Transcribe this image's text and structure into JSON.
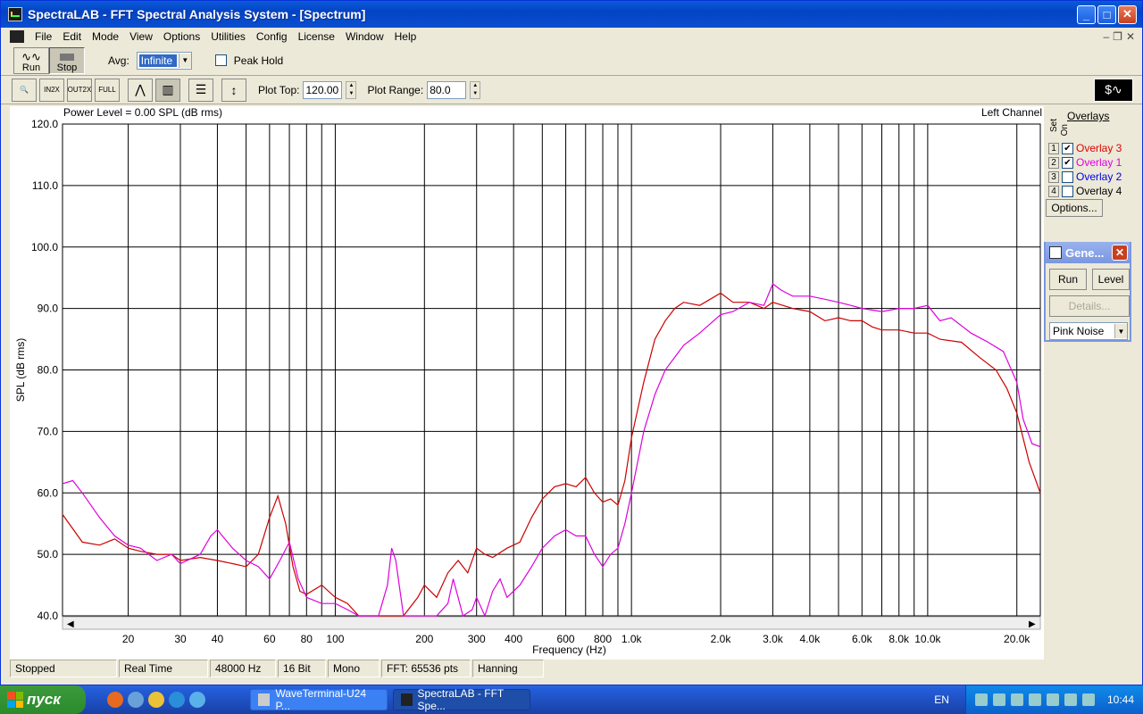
{
  "window": {
    "title": "SpectraLAB - FFT Spectral Analysis System - [Spectrum]",
    "menu": [
      "File",
      "Edit",
      "Mode",
      "View",
      "Options",
      "Utilities",
      "Config",
      "License",
      "Window",
      "Help"
    ]
  },
  "toolbar": {
    "run_label": "Run",
    "stop_label": "Stop",
    "avg_label": "Avg:",
    "avg_value": "Infinite",
    "peak_hold_label": "Peak Hold",
    "plot_top_label": "Plot Top:",
    "plot_top_value": "120.00",
    "plot_range_label": "Plot Range:",
    "plot_range_value": "80.0",
    "tools": [
      "zoom",
      "zoom-in-2x",
      "zoom-out-2x",
      "zoom-out-full",
      "line-mode",
      "bar-mode",
      "legend",
      "autoscale"
    ]
  },
  "chart": {
    "power_level": "Power Level = 0.00 SPL (dB rms)",
    "channel": "Left Channel"
  },
  "overlays": {
    "title": "Overlays",
    "set_label": "Set",
    "on_label": "On",
    "items": [
      {
        "num": "1",
        "label": "Overlay 3",
        "checked": true,
        "color": "#e00000"
      },
      {
        "num": "2",
        "label": "Overlay 1",
        "checked": true,
        "color": "#e000e0"
      },
      {
        "num": "3",
        "label": "Overlay 2",
        "checked": false,
        "color": "#0000e0"
      },
      {
        "num": "4",
        "label": "Overlay 4",
        "checked": false,
        "color": "#000000"
      }
    ],
    "options_label": "Options..."
  },
  "generator": {
    "title": "Gene...",
    "run_label": "Run",
    "level_label": "Level",
    "details_label": "Details...",
    "signal": "Pink Noise"
  },
  "status": [
    "Stopped",
    "Real Time",
    "48000 Hz",
    "16 Bit",
    "Mono",
    "FFT: 65536 pts",
    "Hanning"
  ],
  "taskbar": {
    "start_label": "пуск",
    "tasks": [
      {
        "label": "WaveTerminal-U24 P...",
        "active": false
      },
      {
        "label": "SpectraLAB - FFT Spe...",
        "active": true
      }
    ],
    "lang": "EN",
    "clock": "10:44"
  },
  "chart_data": {
    "type": "line",
    "xlabel": "Frequency (Hz)",
    "ylabel": "SPL (dB rms)",
    "x_scale": "log",
    "xlim": [
      12,
      24000
    ],
    "ylim": [
      40,
      120
    ],
    "y_ticks": [
      "40.0",
      "50.0",
      "60.0",
      "70.0",
      "80.0",
      "90.0",
      "100.0",
      "110.0",
      "120.0"
    ],
    "x_tick_labels": [
      {
        "f": 20,
        "label": "20"
      },
      {
        "f": 30,
        "label": "30"
      },
      {
        "f": 40,
        "label": "40"
      },
      {
        "f": 60,
        "label": "60"
      },
      {
        "f": 80,
        "label": "80"
      },
      {
        "f": 100,
        "label": "100"
      },
      {
        "f": 200,
        "label": "200"
      },
      {
        "f": 300,
        "label": "300"
      },
      {
        "f": 400,
        "label": "400"
      },
      {
        "f": 600,
        "label": "600"
      },
      {
        "f": 800,
        "label": "800"
      },
      {
        "f": 1000,
        "label": "1.0k"
      },
      {
        "f": 2000,
        "label": "2.0k"
      },
      {
        "f": 3000,
        "label": "3.0k"
      },
      {
        "f": 4000,
        "label": "4.0k"
      },
      {
        "f": 6000,
        "label": "6.0k"
      },
      {
        "f": 8000,
        "label": "8.0k"
      },
      {
        "f": 10000,
        "label": "10.0k"
      },
      {
        "f": 20000,
        "label": "20.0k"
      }
    ],
    "grid_lines": [
      20,
      30,
      40,
      50,
      60,
      70,
      80,
      90,
      100,
      200,
      300,
      400,
      500,
      600,
      700,
      800,
      900,
      1000,
      2000,
      3000,
      4000,
      5000,
      6000,
      7000,
      8000,
      9000,
      10000,
      20000
    ],
    "grid": true,
    "series": [
      {
        "color": "#cc0000",
        "points": [
          [
            12,
            56.5
          ],
          [
            14,
            52
          ],
          [
            16,
            51.5
          ],
          [
            18,
            52.5
          ],
          [
            20,
            51
          ],
          [
            22,
            50.5
          ],
          [
            25,
            50
          ],
          [
            28,
            50
          ],
          [
            30,
            49
          ],
          [
            35,
            49.5
          ],
          [
            40,
            49
          ],
          [
            45,
            48.5
          ],
          [
            50,
            48
          ],
          [
            55,
            50
          ],
          [
            60,
            56
          ],
          [
            64,
            59.5
          ],
          [
            68,
            55
          ],
          [
            72,
            48
          ],
          [
            76,
            44
          ],
          [
            80,
            43.5
          ],
          [
            90,
            45
          ],
          [
            100,
            43
          ],
          [
            110,
            42
          ],
          [
            120,
            40
          ],
          [
            150,
            40
          ],
          [
            170,
            40
          ],
          [
            190,
            43
          ],
          [
            200,
            45
          ],
          [
            220,
            43
          ],
          [
            240,
            47
          ],
          [
            260,
            49
          ],
          [
            280,
            47
          ],
          [
            300,
            51
          ],
          [
            320,
            50
          ],
          [
            340,
            49.5
          ],
          [
            380,
            51
          ],
          [
            420,
            52
          ],
          [
            460,
            56
          ],
          [
            500,
            59
          ],
          [
            550,
            61
          ],
          [
            600,
            61.5
          ],
          [
            650,
            61
          ],
          [
            700,
            62.5
          ],
          [
            750,
            60
          ],
          [
            800,
            58.5
          ],
          [
            850,
            59
          ],
          [
            900,
            58
          ],
          [
            950,
            62
          ],
          [
            1000,
            69
          ],
          [
            1100,
            78
          ],
          [
            1200,
            85
          ],
          [
            1300,
            88
          ],
          [
            1400,
            90
          ],
          [
            1500,
            91
          ],
          [
            1700,
            90.5
          ],
          [
            2000,
            92.5
          ],
          [
            2200,
            91
          ],
          [
            2500,
            91
          ],
          [
            2800,
            90
          ],
          [
            3000,
            91
          ],
          [
            3500,
            90
          ],
          [
            4000,
            89.5
          ],
          [
            4500,
            88
          ],
          [
            5000,
            88.5
          ],
          [
            5500,
            88
          ],
          [
            6000,
            88
          ],
          [
            6500,
            87
          ],
          [
            7000,
            86.5
          ],
          [
            8000,
            86.5
          ],
          [
            9000,
            86
          ],
          [
            10000,
            86
          ],
          [
            11000,
            85
          ],
          [
            13000,
            84.5
          ],
          [
            15000,
            82
          ],
          [
            17000,
            80
          ],
          [
            18500,
            77
          ],
          [
            20000,
            73
          ],
          [
            22000,
            65
          ],
          [
            24000,
            60
          ]
        ]
      },
      {
        "color": "#dd00dd",
        "points": [
          [
            12,
            61.5
          ],
          [
            13,
            62
          ],
          [
            14,
            60
          ],
          [
            16,
            56
          ],
          [
            18,
            53
          ],
          [
            20,
            51.5
          ],
          [
            22,
            51
          ],
          [
            25,
            49
          ],
          [
            28,
            50
          ],
          [
            30,
            48.5
          ],
          [
            35,
            50
          ],
          [
            38,
            53
          ],
          [
            40,
            54
          ],
          [
            45,
            51
          ],
          [
            50,
            49
          ],
          [
            55,
            48
          ],
          [
            60,
            46
          ],
          [
            65,
            49
          ],
          [
            70,
            52
          ],
          [
            75,
            46
          ],
          [
            80,
            43
          ],
          [
            90,
            42
          ],
          [
            100,
            42
          ],
          [
            110,
            41
          ],
          [
            120,
            40
          ],
          [
            140,
            40
          ],
          [
            150,
            45
          ],
          [
            155,
            51
          ],
          [
            160,
            49
          ],
          [
            170,
            40
          ],
          [
            180,
            40
          ],
          [
            200,
            40
          ],
          [
            220,
            40
          ],
          [
            240,
            42
          ],
          [
            250,
            46
          ],
          [
            270,
            40
          ],
          [
            290,
            41
          ],
          [
            300,
            43
          ],
          [
            320,
            40
          ],
          [
            340,
            44
          ],
          [
            360,
            46
          ],
          [
            380,
            43
          ],
          [
            420,
            45
          ],
          [
            460,
            48
          ],
          [
            500,
            51
          ],
          [
            550,
            53
          ],
          [
            600,
            54
          ],
          [
            650,
            53
          ],
          [
            700,
            53
          ],
          [
            750,
            50
          ],
          [
            800,
            48
          ],
          [
            850,
            50
          ],
          [
            900,
            51
          ],
          [
            950,
            55
          ],
          [
            1000,
            60
          ],
          [
            1100,
            70
          ],
          [
            1200,
            76
          ],
          [
            1300,
            80
          ],
          [
            1500,
            84
          ],
          [
            1700,
            86
          ],
          [
            2000,
            89
          ],
          [
            2200,
            89.5
          ],
          [
            2500,
            91
          ],
          [
            2800,
            90.5
          ],
          [
            3000,
            94
          ],
          [
            3200,
            93
          ],
          [
            3500,
            92
          ],
          [
            4000,
            92
          ],
          [
            4500,
            91.5
          ],
          [
            5000,
            91
          ],
          [
            5500,
            90.5
          ],
          [
            6000,
            90
          ],
          [
            7000,
            89.5
          ],
          [
            8000,
            90
          ],
          [
            9000,
            90
          ],
          [
            10000,
            90.5
          ],
          [
            11000,
            88
          ],
          [
            12000,
            88.5
          ],
          [
            14000,
            86
          ],
          [
            16000,
            84.5
          ],
          [
            18000,
            83
          ],
          [
            20000,
            78
          ],
          [
            21000,
            72
          ],
          [
            22500,
            68
          ],
          [
            24000,
            67.5
          ]
        ]
      }
    ]
  }
}
